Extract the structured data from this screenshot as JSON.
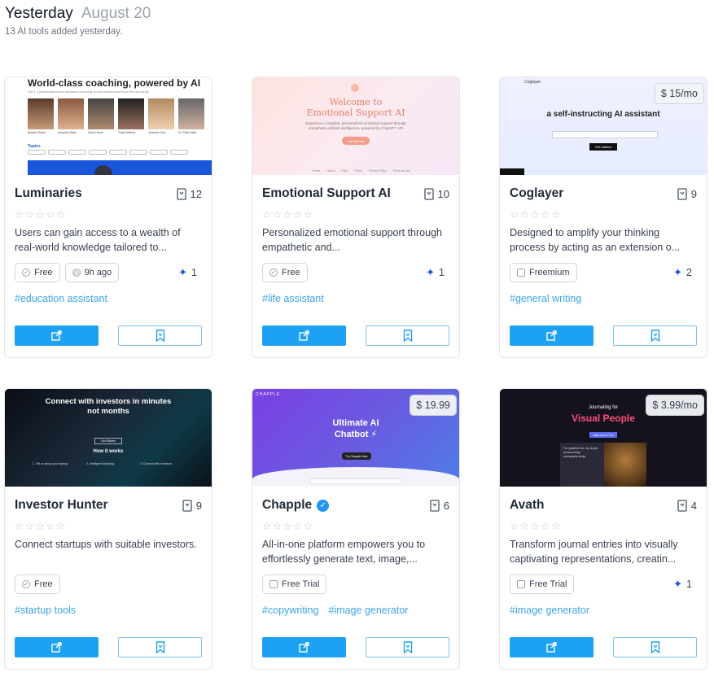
{
  "header": {
    "day": "Yesterday",
    "date": "August 20",
    "subtitle": "13 AI tools added yesterday."
  },
  "colors": {
    "accent": "#1da1f2",
    "tag": "#3ba4e8",
    "sparkle": "#1e4fd8",
    "verified": "#2196f3"
  },
  "cards": [
    {
      "name": "Luminaries",
      "saves": "12",
      "description": "Users can gain access to a wealth of real-world knowledge tailored to...",
      "badges": [
        {
          "label": "Free",
          "icon": "check-circle-icon"
        },
        {
          "label": "9h ago",
          "icon": "clock-icon"
        }
      ],
      "sparkle_count": "1",
      "tags": [
        "#education assistant"
      ],
      "screenshot": {
        "headline": "World-class coaching, powered by AI",
        "subline": "Get 1:1 personalized and unbiased coaching on real world topics from the top minds",
        "people": [
          "Bradley Rubin",
          "Amanda Zetler",
          "Dave Harris",
          "Tony Robbins",
          "Jenessa Cork",
          "Dr. Peter Attia"
        ],
        "topics_label": "Topics"
      }
    },
    {
      "name": "Emotional Support AI",
      "saves": "10",
      "description": "Personalized emotional support through empathetic and...",
      "badges": [
        {
          "label": "Free",
          "icon": "check-circle-icon"
        }
      ],
      "sparkle_count": "1",
      "tags": [
        "#life assistant"
      ],
      "screenshot": {
        "headline_1": "Welcome to",
        "headline_2": "Emotional Support AI",
        "subline": "Experience complete, personalized emotional support through empathetic artificial intelligence, powered by ChatGPT API",
        "cta": "Get Started",
        "nav": [
          "Home",
          "How It",
          "Price",
          "Prices",
          "Privacy Policy",
          "Terms of Use"
        ]
      }
    },
    {
      "name": "Coglayer",
      "saves": "9",
      "price": "$ 15/mo",
      "description": "Designed to amplify your thinking process by acting as an extension o...",
      "badges": [
        {
          "label": "Freemium",
          "icon": "lock-icon"
        }
      ],
      "sparkle_count": "2",
      "tags": [
        "#general writing"
      ],
      "screenshot": {
        "brand": "Coglayer",
        "headline": "a self-instructing AI assistant",
        "cta": "Get started"
      }
    },
    {
      "name": "Investor Hunter",
      "saves": "9",
      "description": "Connect startups with suitable investors.",
      "badges": [
        {
          "label": "Free",
          "icon": "check-circle-icon"
        }
      ],
      "tags": [
        "#startup tools"
      ],
      "screenshot": {
        "headline_1": "Connect with investors in minutes",
        "headline_2": "not months",
        "how": "How it works",
        "cta": "Get Started",
        "steps": [
          "1. Tell us about your startup",
          "2. Intelligent Matching",
          "3. Connect with investors"
        ]
      }
    },
    {
      "name": "Chapple",
      "verified": true,
      "saves": "6",
      "price": "$ 19.99",
      "description": "All-in-one platform empowers you to effortlessly generate text, image,...",
      "badges": [
        {
          "label": "Free Trial",
          "icon": "lock-icon"
        }
      ],
      "tags": [
        "#copywriting",
        "#image generator"
      ],
      "screenshot": {
        "brand": "CHAPPLE",
        "headline_1": "Ultimate AI",
        "headline_2": "Chatbot",
        "cta": "Try Chapple Now"
      }
    },
    {
      "name": "Avath",
      "saves": "4",
      "price": "$ 3.99/mo",
      "description": "Transform journal entries into visually captivating representations, creatin...",
      "badges": [
        {
          "label": "Free Trial",
          "icon": "lock-icon"
        }
      ],
      "sparkle_count": "1",
      "tags": [
        "#image generator"
      ],
      "screenshot": {
        "kicker": "Journaling for",
        "headline": "Visual People",
        "cta": "Sign up for Free",
        "journal": "I'm grateful for my dog's unwavering companionship."
      }
    }
  ]
}
